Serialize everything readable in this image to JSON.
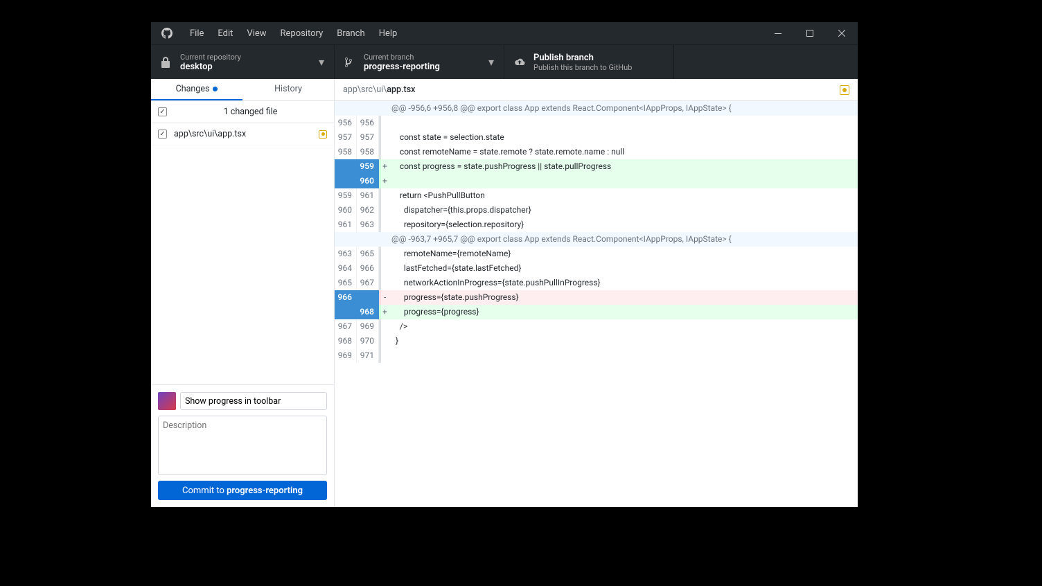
{
  "menu": [
    "File",
    "Edit",
    "View",
    "Repository",
    "Branch",
    "Help"
  ],
  "toolbar": {
    "repo_label": "Current repository",
    "repo_value": "desktop",
    "branch_label": "Current branch",
    "branch_value": "progress-reporting",
    "publish_title": "Publish branch",
    "publish_sub": "Publish this branch to GitHub"
  },
  "tabs": {
    "changes": "Changes",
    "history": "History"
  },
  "changes": {
    "count_label": "1 changed file",
    "files": [
      {
        "path": "app\\src\\ui\\app.tsx"
      }
    ]
  },
  "commit": {
    "summary": "Show progress in toolbar",
    "desc_placeholder": "Description",
    "button_prefix": "Commit to ",
    "button_branch": "progress-reporting"
  },
  "diff": {
    "path_prefix": "app\\src\\ui\\",
    "path_file": "app.tsx",
    "lines": [
      {
        "type": "hunk",
        "old": "",
        "new": "",
        "mark": "",
        "code": "@@ -956,6 +956,8 @@ export class App extends React.Component<IAppProps, IAppState> {"
      },
      {
        "type": "ctx",
        "old": "956",
        "new": "956",
        "mark": "",
        "code": ""
      },
      {
        "type": "ctx",
        "old": "957",
        "new": "957",
        "mark": "",
        "code": "    const state = selection.state"
      },
      {
        "type": "ctx",
        "old": "958",
        "new": "958",
        "mark": "",
        "code": "    const remoteName = state.remote ? state.remote.name : null"
      },
      {
        "type": "add",
        "old": "",
        "new": "959",
        "mark": "+",
        "code": "    const progress = state.pushProgress || state.pullProgress",
        "selOld": true,
        "selNew": true
      },
      {
        "type": "add",
        "old": "",
        "new": "960",
        "mark": "+",
        "code": "",
        "selOld": true,
        "selNew": true
      },
      {
        "type": "ctx",
        "old": "959",
        "new": "961",
        "mark": "",
        "code": "    return <PushPullButton"
      },
      {
        "type": "ctx",
        "old": "960",
        "new": "962",
        "mark": "",
        "code": "      dispatcher={this.props.dispatcher}"
      },
      {
        "type": "ctx",
        "old": "961",
        "new": "963",
        "mark": "",
        "code": "      repository={selection.repository}"
      },
      {
        "type": "hunk",
        "old": "",
        "new": "",
        "mark": "",
        "code": "@@ -963,7 +965,7 @@ export class App extends React.Component<IAppProps, IAppState> {"
      },
      {
        "type": "ctx",
        "old": "963",
        "new": "965",
        "mark": "",
        "code": "      remoteName={remoteName}"
      },
      {
        "type": "ctx",
        "old": "964",
        "new": "966",
        "mark": "",
        "code": "      lastFetched={state.lastFetched}"
      },
      {
        "type": "ctx",
        "old": "965",
        "new": "967",
        "mark": "",
        "code": "      networkActionInProgress={state.pushPullInProgress}"
      },
      {
        "type": "del",
        "old": "966",
        "new": "",
        "mark": "-",
        "code": "      progress={state.pushProgress}",
        "selOld": true,
        "selNew": true
      },
      {
        "type": "add",
        "old": "",
        "new": "968",
        "mark": "+",
        "code": "      progress={progress}",
        "selOld": true,
        "selNew": true
      },
      {
        "type": "ctx",
        "old": "967",
        "new": "969",
        "mark": "",
        "code": "    />"
      },
      {
        "type": "ctx",
        "old": "968",
        "new": "970",
        "mark": "",
        "code": "  }"
      },
      {
        "type": "ctx",
        "old": "969",
        "new": "971",
        "mark": "",
        "code": ""
      }
    ]
  }
}
